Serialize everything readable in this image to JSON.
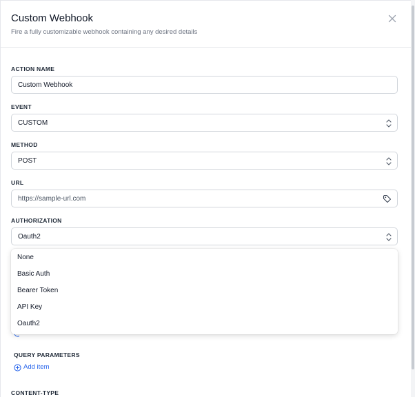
{
  "header": {
    "title": "Custom Webhook",
    "subtitle": "Fire a fully customizable webhook containing any desired details",
    "close_icon": "close-icon"
  },
  "form": {
    "action_name": {
      "label": "ACTION NAME",
      "value": "Custom Webhook"
    },
    "event": {
      "label": "EVENT",
      "value": "CUSTOM",
      "icon": "select-arrows-icon"
    },
    "method": {
      "label": "METHOD",
      "value": "POST",
      "icon": "select-arrows-icon"
    },
    "url": {
      "label": "URL",
      "value": "https://sample-url.com",
      "icon": "tag-icon"
    },
    "authorization": {
      "label": "AUTHORIZATION",
      "value": "Oauth2",
      "icon": "select-arrows-icon",
      "options": [
        "None",
        "Basic Auth",
        "Bearer Token",
        "API Key",
        "Oauth2"
      ]
    },
    "query_parameters": {
      "label": "QUERY PARAMETERS",
      "add_label": "Add item",
      "add_icon": "plus-circle-icon"
    },
    "content_type": {
      "label": "CONTENT-TYPE"
    }
  },
  "colors": {
    "accent": "#2563eb",
    "border": "#d1d5db",
    "muted_text": "#6b7280"
  }
}
